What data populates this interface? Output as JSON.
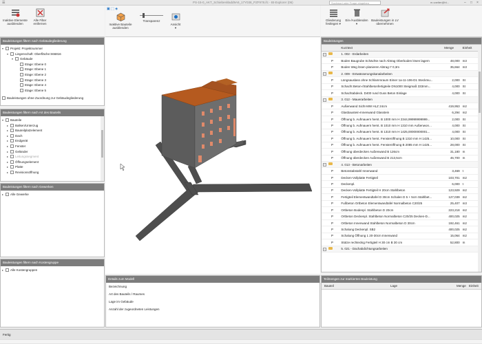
{
  "window": {
    "title": "PS-15-0_AKT_Schiebeskladd9A9_17Y038_PZF978.ifc - Bt-Explorer (06)",
    "search_placeholder": "Suchwort oder Frage eingeben",
    "user": "m.voelter@hl..."
  },
  "ribbon_left": [
    {
      "label": "Inaktive Elemente\nausblenden",
      "icon": "list-filter-icon"
    },
    {
      "label": "Alle Filter\nentfernen",
      "icon": "clear-filter-icon"
    }
  ],
  "ribbon_mid": {
    "inactive_label": "Inaktive Bauteile\nausblenden",
    "transparency_label": "Transparenz",
    "view_label": "Ansicht\n▾"
  },
  "ribbon_right": [
    {
      "label": "Gliederung\nfestlegen ▾",
      "icon": "outline-icon"
    },
    {
      "label": "Ein-/Ausblenden\n▾",
      "icon": "show-hide-icon"
    },
    {
      "label": "Bauleistungen in LV\nübernehmen",
      "icon": "transfer-icon"
    }
  ],
  "panel_building": {
    "title": "Bauleistungen filtern nach Gebäudegliederung",
    "nodes": [
      {
        "label": "Projekt: Projektnummer",
        "indent": 0,
        "exp": "▾"
      },
      {
        "label": "Liegenschaft: Oberfläche:S66816",
        "indent": 1,
        "exp": "▾"
      },
      {
        "label": "Gebäude",
        "indent": 2,
        "exp": "▾"
      },
      {
        "label": "Etage: Ebene 0",
        "indent": 3,
        "exp": ""
      },
      {
        "label": "Etage: Ebene 1",
        "indent": 3,
        "exp": ""
      },
      {
        "label": "Etage: Ebene 2",
        "indent": 3,
        "exp": ""
      },
      {
        "label": "Etage: Ebene 3",
        "indent": 3,
        "exp": ""
      },
      {
        "label": "Etage: Ebene 4",
        "indent": 3,
        "exp": ""
      },
      {
        "label": "Etage: Ebene 5",
        "indent": 3,
        "exp": ""
      }
    ],
    "footer_item": "Bauleistungen ohne Zuordnung zur Gebäudegliederung"
  },
  "panel_type": {
    "title": "Bauleistungen filtern nach Art des Bauteils",
    "nodes": [
      {
        "label": "Bauteile",
        "indent": 0,
        "exp": "▾",
        "muted": false
      },
      {
        "label": "Balken/Unterzug",
        "indent": 1,
        "exp": "▸",
        "muted": false
      },
      {
        "label": "Bauteilplatzelement",
        "indent": 1,
        "exp": "▸",
        "muted": false
      },
      {
        "label": "Dach",
        "indent": 1,
        "exp": "▸",
        "muted": false
      },
      {
        "label": "Endgerät",
        "indent": 1,
        "exp": "▸",
        "muted": false
      },
      {
        "label": "Fenster",
        "indent": 1,
        "exp": "▸",
        "muted": false
      },
      {
        "label": "Geländer",
        "indent": 1,
        "exp": "▸",
        "muted": false
      },
      {
        "label": "Leitungssegment",
        "indent": 1,
        "exp": "▸",
        "muted": true
      },
      {
        "label": "Öffnungselement",
        "indent": 1,
        "exp": "▸",
        "muted": false
      },
      {
        "label": "Platte",
        "indent": 1,
        "exp": "▸",
        "muted": false
      },
      {
        "label": "Revisionsöffnung",
        "indent": 1,
        "exp": "▸",
        "muted": false
      }
    ]
  },
  "panel_trades": {
    "title": "Bauleistungen filtern nach Gewerken",
    "item": "Alle Gewerke"
  },
  "panel_cost": {
    "title": "Bauleistungen filtern nach Kostengruppe",
    "item": "Alle Kostengruppen"
  },
  "details": {
    "title": "Details zum Modell",
    "lines": [
      "Bezeichnung",
      "Art des Bauteils / Raumes",
      "Lage im Gebäude",
      "Anzahl der zugeordneten Leistungen"
    ]
  },
  "bauleistungen": {
    "title": "Bauleistungen",
    "columns": [
      "Kurztext",
      "Menge",
      "Einheit"
    ],
    "rows": [
      {
        "type": "group",
        "text": "1. 002 - Erdarbeiten",
        "qty": "",
        "unit": ""
      },
      {
        "type": "item",
        "text": "Boden Baugrube Schächte nach Abtrag Oberboden lösen lagern",
        "qty": "48,000",
        "unit": "m3"
      },
      {
        "type": "item",
        "text": "Boden Weg lösen planieren Abtrag-7 0,3m",
        "qty": "35,664",
        "unit": "m3"
      },
      {
        "type": "group",
        "text": "2. 009 - Entwässerungskanalarbeiten",
        "qty": "",
        "unit": ""
      },
      {
        "type": "item",
        "text": "Lüngsauslass ohne Schlammraum Eimer 1a-11-106-D1 Steckmu...",
        "qty": "2,000",
        "unit": "St"
      },
      {
        "type": "item",
        "text": "Schacht Beton-/Stahlbetonfertigteile DN1000 Steigmaß 333mm...",
        "qty": "4,000",
        "unit": "St"
      },
      {
        "type": "item",
        "text": "Schachtabdeck. D400 rund Guss Beton Einlage",
        "qty": "4,000",
        "unit": "St"
      },
      {
        "type": "group",
        "text": "3. 012 - Mauerarbeiten",
        "qty": "",
        "unit": ""
      },
      {
        "type": "item",
        "text": "Außenwand Sicht-MW HLZ 24cm",
        "qty": "419,953",
        "unit": "m2"
      },
      {
        "type": "item",
        "text": "Glasbaustein-Innenwand Glasstein",
        "qty": "6,294",
        "unit": "m2"
      },
      {
        "type": "item",
        "text": "Öffnung b. Aufmauern herst. B 1000 mm H 2344,99999999999...",
        "qty": "2,000",
        "unit": "St"
      },
      {
        "type": "item",
        "text": "Öffnung b. Aufmauern herst. B 1010 mm H 1310 mm Außenwon...",
        "qty": "4,000",
        "unit": "St"
      },
      {
        "type": "item",
        "text": "Öffnung b. Aufmauern herst. B 1310 mm H 1425,00000000001...",
        "qty": "4,000",
        "unit": "St"
      },
      {
        "type": "item",
        "text": "Öffnung b. Aufmauern herst. Fensteröffnung B 1310 mm H 1425...",
        "qty": "10,000",
        "unit": "St"
      },
      {
        "type": "item",
        "text": "Öffnung b. Aufmauern herst. Fensteröffnung B 2085 mm H 1425...",
        "qty": "28,000",
        "unit": "St"
      },
      {
        "type": "item",
        "text": "Öffnung überdecken Außenwand B 126cm",
        "qty": "31,180",
        "unit": "m"
      },
      {
        "type": "item",
        "text": "Öffnung überdecken Außenwand B 213,5cm",
        "qty": "46,700",
        "unit": "m"
      },
      {
        "type": "group",
        "text": "4. 013 - Betonarbeiten",
        "qty": "",
        "unit": ""
      },
      {
        "type": "item",
        "text": "Betonstabstahl Innenwand",
        "qty": "3,469",
        "unit": "t"
      },
      {
        "type": "item",
        "text": "Decken-Vollplatte Fertigteil",
        "qty": "103,701",
        "unit": "m2"
      },
      {
        "type": "item",
        "text": "Deckenpl.",
        "qty": "6,000",
        "unit": "t"
      },
      {
        "type": "item",
        "text": "Decken-Vollplatte Fertigteil H 20cm Stahlbeton",
        "qty": "123,929",
        "unit": "m2"
      },
      {
        "type": "item",
        "text": "Fertigteil Elementwandtafel D 30cm Schalen D 5 + 5cm Stahlbet...",
        "qty": "127,039",
        "unit": "m2"
      },
      {
        "type": "item",
        "text": "Fußbeton Ortbeton Elementwandtafel Normalbeton C20/25",
        "qty": "25,407",
        "unit": "m3"
      },
      {
        "type": "item",
        "text": "Ortbeton Bodenpl. Stahlbeton D 20cm",
        "qty": "223,218",
        "unit": "m2"
      },
      {
        "type": "item",
        "text": "Ortbeton Deckenpl. Stahlbeton Normalbeton C20/25 Decken-D...",
        "qty": "400,025",
        "unit": "m2"
      },
      {
        "type": "item",
        "text": "Ortbeton Innenwand Stahlbeton Normalbeton D 30cm",
        "qty": "192,461",
        "unit": "m2"
      },
      {
        "type": "item",
        "text": "Schalung Deckenpl. SB2",
        "qty": "400,025",
        "unit": "m2"
      },
      {
        "type": "item",
        "text": "Schalung Öffnung 1 20-30cm Innenwand",
        "qty": "15,064",
        "unit": "m2"
      },
      {
        "type": "item",
        "text": "Stütze rechteckig Fertigteil H 30 cm B 30 cm",
        "qty": "52,800",
        "unit": "m"
      },
      {
        "type": "group",
        "text": "5. 021 - Dachabdichtungsarbeiten",
        "qty": "",
        "unit": ""
      }
    ]
  },
  "assigned": {
    "title": "Teilmengen zur markierten Bauleistung",
    "columns": [
      "Bauteil",
      "Lage",
      "Menge",
      "Einheit"
    ]
  },
  "status": {
    "text": "Fertig"
  },
  "colors": {
    "panel_header": "#7c7c7c",
    "roof": "#b55a1f",
    "building_wall": "#6a6a6a",
    "road": "#4a4a4a",
    "folder": "#e9b84a"
  }
}
